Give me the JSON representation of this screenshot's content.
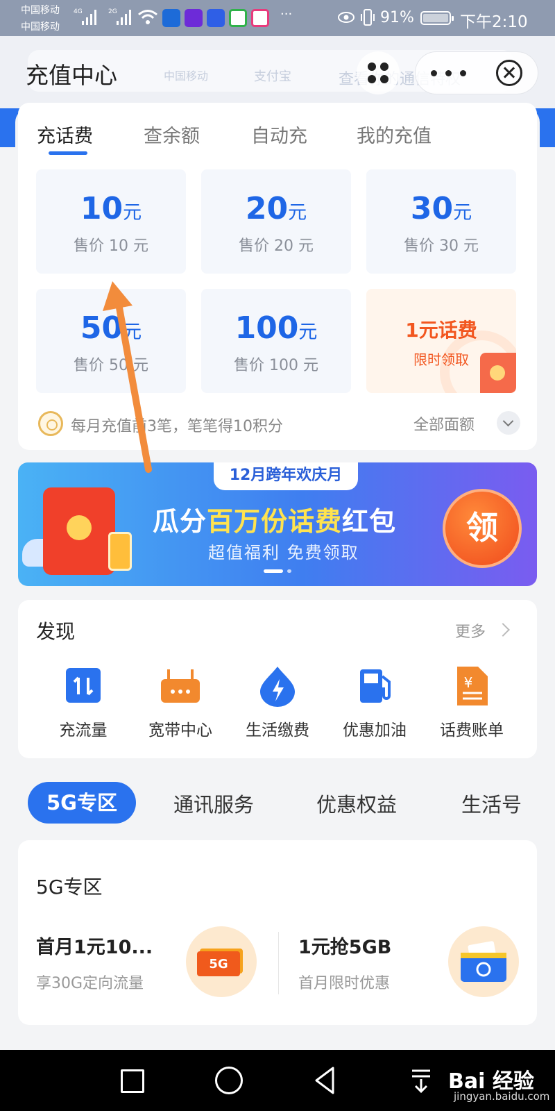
{
  "status_bar": {
    "carrier1": "中国移动",
    "carrier2": "中国移动",
    "net1": "4G",
    "net2": "2G",
    "battery": "91%",
    "time": "下午2:10",
    "overflow": "···"
  },
  "header": {
    "title": "充值中心",
    "faded_left": "中国移动",
    "faded_mid": "支付宝",
    "faded_right": "查看你的通信特权"
  },
  "tabs": [
    "充话费",
    "查余额",
    "自动充",
    "我的充值"
  ],
  "denominations": [
    {
      "amount": "10",
      "unit": "元",
      "price": "售价 10 元"
    },
    {
      "amount": "20",
      "unit": "元",
      "price": "售价 20 元"
    },
    {
      "amount": "30",
      "unit": "元",
      "price": "售价 30 元"
    },
    {
      "amount": "50",
      "unit": "元",
      "price": "售价 50 元"
    },
    {
      "amount": "100",
      "unit": "元",
      "price": "售价 100 元"
    }
  ],
  "promo_tile": {
    "title": "1元话费",
    "subtitle": "限时领取"
  },
  "points_note": "每月充值前3笔，笔笔得10积分",
  "all_denominations": "全部面额",
  "banner": {
    "tag": "12月跨年欢庆月",
    "title_a": "瓜分",
    "title_hl": "百万份话费",
    "title_b": "红包",
    "subtitle": "超值福利 免费领取",
    "claim": "领"
  },
  "discover": {
    "title": "发现",
    "more": "更多",
    "items": [
      {
        "label": "充流量",
        "icon": "data-transfer-icon"
      },
      {
        "label": "宽带中心",
        "icon": "router-icon"
      },
      {
        "label": "生活缴费",
        "icon": "lightning-drop-icon"
      },
      {
        "label": "优惠加油",
        "icon": "fuel-pump-icon"
      },
      {
        "label": "话费账单",
        "icon": "bill-document-icon"
      }
    ]
  },
  "categories": [
    "5G专区",
    "通讯服务",
    "优惠权益",
    "生活号"
  ],
  "section_5g": {
    "title": "5G专区",
    "offers": [
      {
        "title": "首月1元10...",
        "subtitle": "享30G定向流量",
        "icon": "5g-ticket-icon",
        "badge": "5G"
      },
      {
        "title": "1元抢5GB",
        "subtitle": "首月限时优惠",
        "icon": "sim-wallet-icon"
      }
    ]
  },
  "watermark": {
    "main": "Bai 经验",
    "sub": "jingyan.baidu.com"
  },
  "colors": {
    "brand_blue": "#2a72ee",
    "promo_orange": "#f2561f",
    "annotation_arrow": "#f28c3c"
  }
}
